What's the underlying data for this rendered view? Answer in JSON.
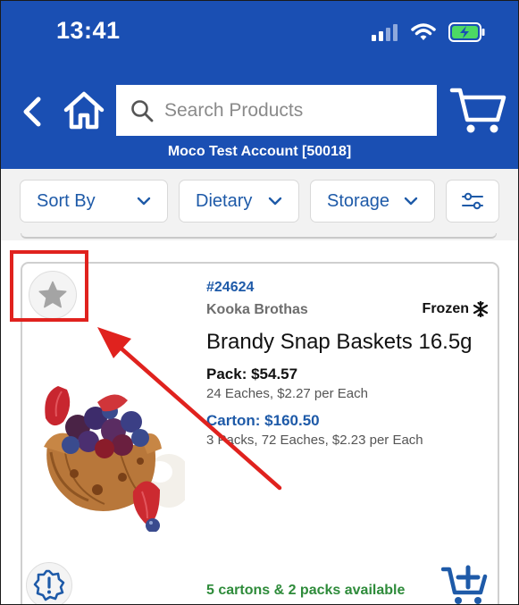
{
  "status_bar": {
    "time": "13:41"
  },
  "header": {
    "search_placeholder": "Search Products",
    "account_name": "Moco Test Account [50018]"
  },
  "filters": {
    "sort_label": "Sort By",
    "dietary_label": "Dietary",
    "storage_label": "Storage"
  },
  "product": {
    "code": "#24624",
    "brand": "Kooka Brothas",
    "storage": "Frozen",
    "name": "Brandy Snap Baskets 16.5g",
    "pack_price": "Pack: $54.57",
    "pack_detail": "24 Eaches, $2.27 per Each",
    "carton_price": "Carton: $160.50",
    "carton_detail": "3 Packs, 72 Eaches, $2.23 per Each",
    "availability": "5 cartons & 2 packs available"
  },
  "colors": {
    "header_bg": "#1a4fb3",
    "accent_blue": "#1e5aa8",
    "availability_green": "#2e8b3a",
    "annotation_red": "#e0221e"
  },
  "icons": [
    "signal-icon",
    "wifi-icon",
    "battery-icon",
    "back-icon",
    "home-icon",
    "search-icon",
    "cart-icon",
    "chevron-down-icon",
    "filter-settings-icon",
    "star-icon",
    "snowflake-icon",
    "alert-icon",
    "add-to-cart-icon",
    "annotation-arrow"
  ]
}
